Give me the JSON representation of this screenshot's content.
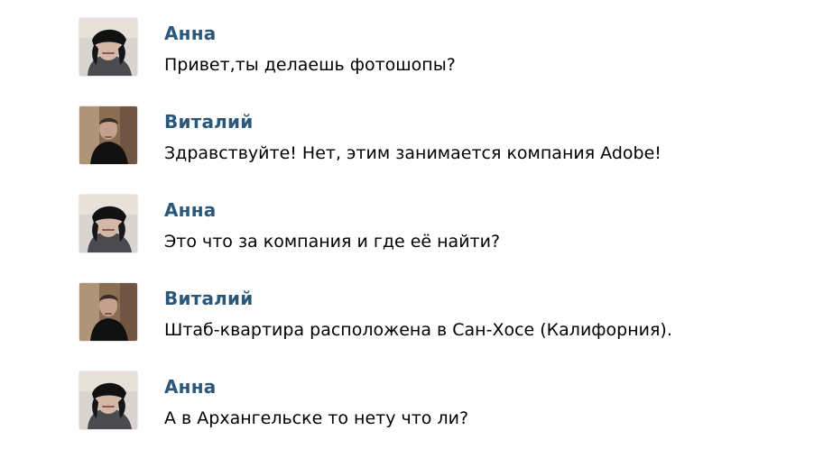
{
  "messages": [
    {
      "author": "Анна",
      "text": "Привет,ты делаешь фотошопы?",
      "avatar": "anna-avatar"
    },
    {
      "author": "Виталий",
      "text": "Здравствуйте! Нет, этим занимается компания Adobe!",
      "avatar": "vitaly-avatar"
    },
    {
      "author": "Анна",
      "text": "Это что за компания и где её найти?",
      "avatar": "anna-avatar"
    },
    {
      "author": "Виталий",
      "text": "Штаб-квартира расположена в Сан-Хосе (Калифорния).",
      "avatar": "vitaly-avatar"
    },
    {
      "author": "Анна",
      "text": "А в Архангельске то нету что ли?",
      "avatar": "anna-avatar"
    }
  ],
  "colors": {
    "author": "#2b587a",
    "text": "#000000",
    "background": "#ffffff"
  }
}
